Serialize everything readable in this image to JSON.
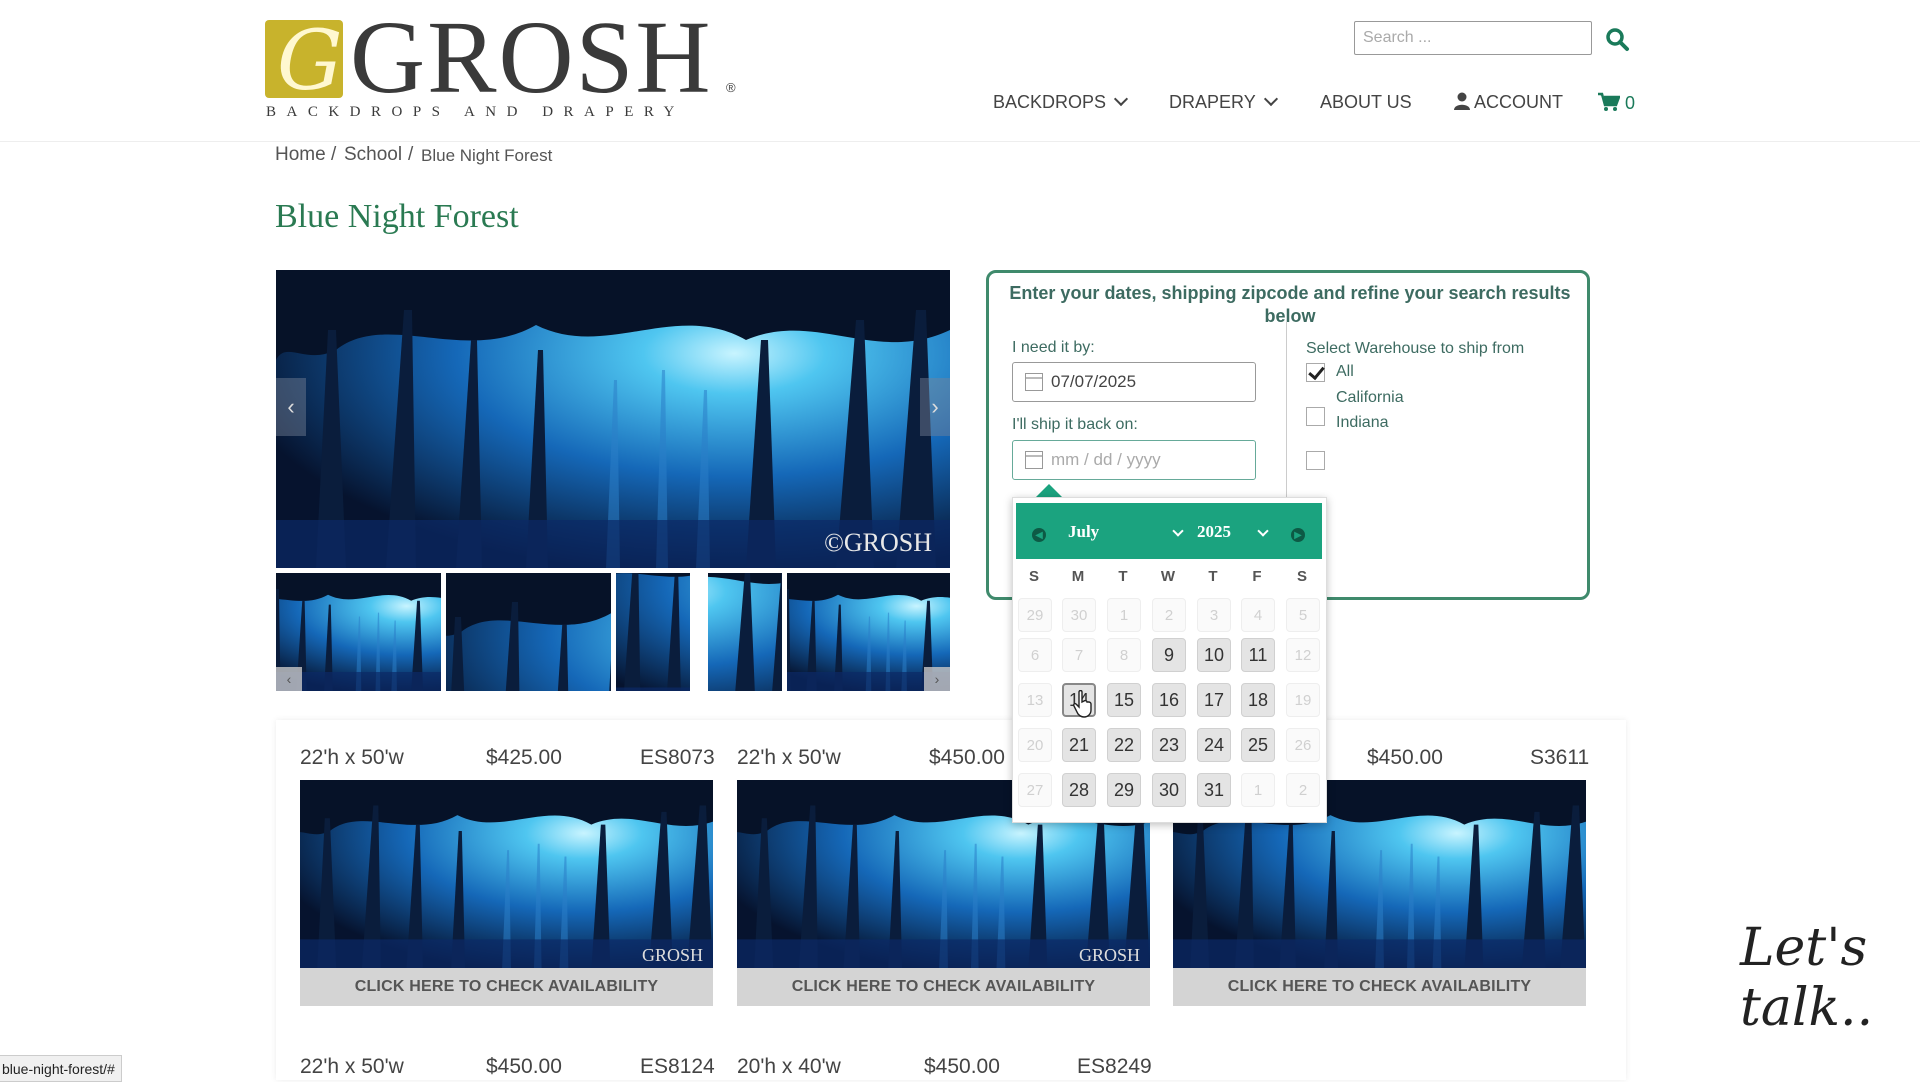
{
  "header": {
    "logo_main": "GROSH",
    "logo_sub": "BACKDROPS AND DRAPERY",
    "logo_mark": "G",
    "search_placeholder": "Search ...",
    "nav": {
      "backdrops": "BACKDROPS",
      "drapery": "DRAPERY",
      "about": "ABOUT US",
      "account": "ACCOUNT",
      "cart_count": "0"
    }
  },
  "breadcrumb": {
    "home": "Home",
    "sep1": "/",
    "school": "School",
    "sep2": "/",
    "current": "Blue Night Forest"
  },
  "page_title": "Blue Night Forest",
  "hero_watermark": "©GROSH",
  "date_panel": {
    "heading": "Enter your dates, shipping zipcode and refine your search results below",
    "need_by_label": "I need it by:",
    "need_by_value": "07/07/2025",
    "ship_back_label": "I'll ship it back on:",
    "ship_back_placeholder": "mm / dd / yyyy",
    "warehouse_label": "Select Warehouse to ship from",
    "warehouses": [
      {
        "label": "All",
        "checked": true
      },
      {
        "label": "California",
        "checked": false
      },
      {
        "label": "Indiana",
        "checked": false
      }
    ]
  },
  "datepicker": {
    "month": "July",
    "year": "2025",
    "weekdays": [
      "S",
      "M",
      "T",
      "W",
      "T",
      "F",
      "S"
    ],
    "weeks": [
      [
        "29",
        "30",
        "1",
        "2",
        "3",
        "4",
        "5"
      ],
      [
        "6",
        "7",
        "8",
        "9",
        "10",
        "11",
        "12"
      ],
      [
        "13",
        "14",
        "15",
        "16",
        "17",
        "18",
        "19"
      ],
      [
        "20",
        "21",
        "22",
        "23",
        "24",
        "25",
        "26"
      ],
      [
        "27",
        "28",
        "29",
        "30",
        "31",
        "1",
        "2"
      ]
    ]
  },
  "products": [
    {
      "size": "22'h x 50'w",
      "price": "$425.00",
      "sku": "ES8073",
      "button": "CLICK HERE TO CHECK AVAILABILITY",
      "watermark": "GROSH"
    },
    {
      "size": "22'h x 50'w",
      "price": "$450.00",
      "sku": "",
      "button": "CLICK HERE TO CHECK AVAILABILITY",
      "watermark": "GROSH"
    },
    {
      "size": "",
      "price": "$450.00",
      "sku": "S3611",
      "button": "CLICK HERE TO CHECK AVAILABILITY",
      "watermark": ""
    },
    {
      "size": "22'h x 50'w",
      "price": "$450.00",
      "sku": "ES8124"
    },
    {
      "size": "20'h x 40'w",
      "price": "$450.00",
      "sku": "ES8249"
    }
  ],
  "chat_label": "Let's talk..",
  "status_url": "blue-night-forest/#",
  "colors": {
    "brand_green": "#2a7a52",
    "picker_green": "#1ba37f",
    "logo_gold": "#c8b32c"
  }
}
